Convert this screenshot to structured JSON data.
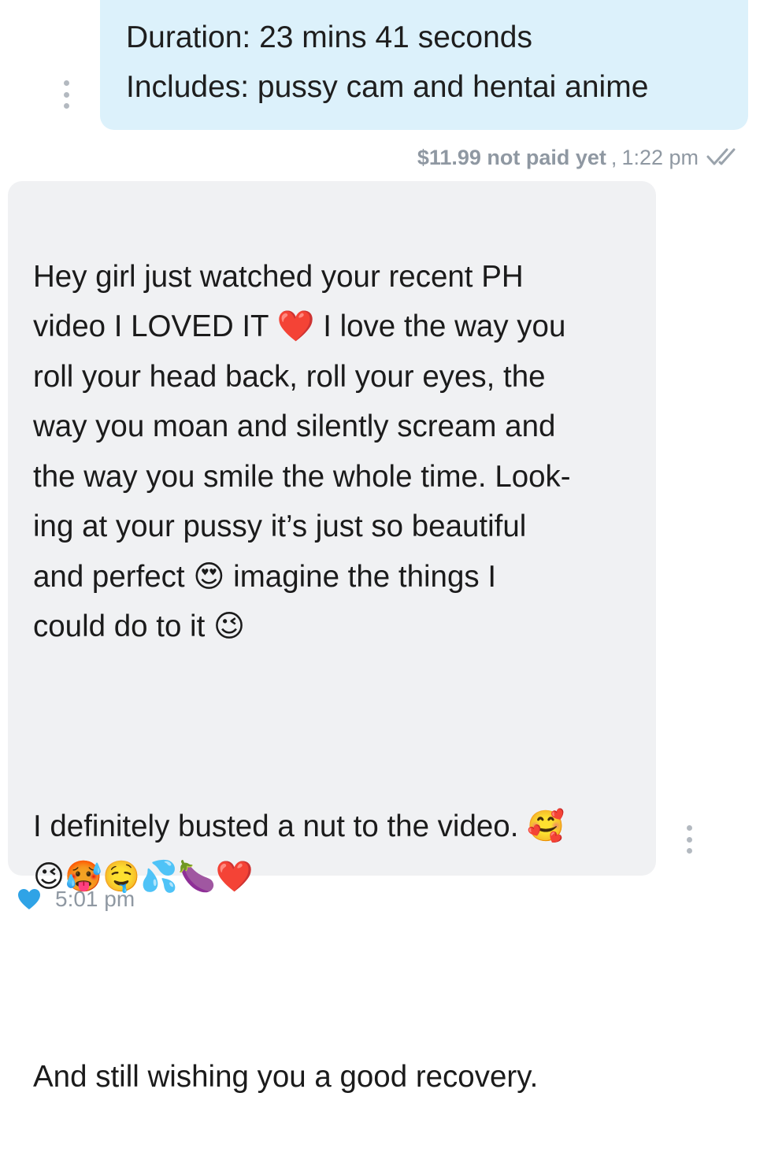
{
  "outgoing_message": {
    "line1": "Duration: 23 mins 41 seconds",
    "line2": "Includes: pussy cam and hentai anime",
    "price_status": "$11.99 not paid yet",
    "separator": ",",
    "time": "1:22 pm",
    "read_icon": "double-check-icon"
  },
  "incoming_message": {
    "paragraph1": "Hey girl just watched your recent PH\nvideo I LOVED IT ❤️ I love the way you\nroll your head back, roll your eyes, the\nway you moan and silently scream and\nthe way you smile the whole time. Look-\ning at your pussy it’s just so beautiful\nand perfect 😍 imagine the things I\ncould do to it 😉",
    "paragraph2": "I definitely busted a nut to the video. 🥰\n😉🥵🤤💦🍆❤️",
    "paragraph3": "And still wishing you a good recovery.",
    "time": "5:01 pm",
    "like_icon": "heart-icon",
    "like_color": "#2fa3e6"
  },
  "colors": {
    "outgoing_bubble": "#dcf1fb",
    "incoming_bubble": "#f0f1f3",
    "meta_text": "#8f98a2"
  }
}
